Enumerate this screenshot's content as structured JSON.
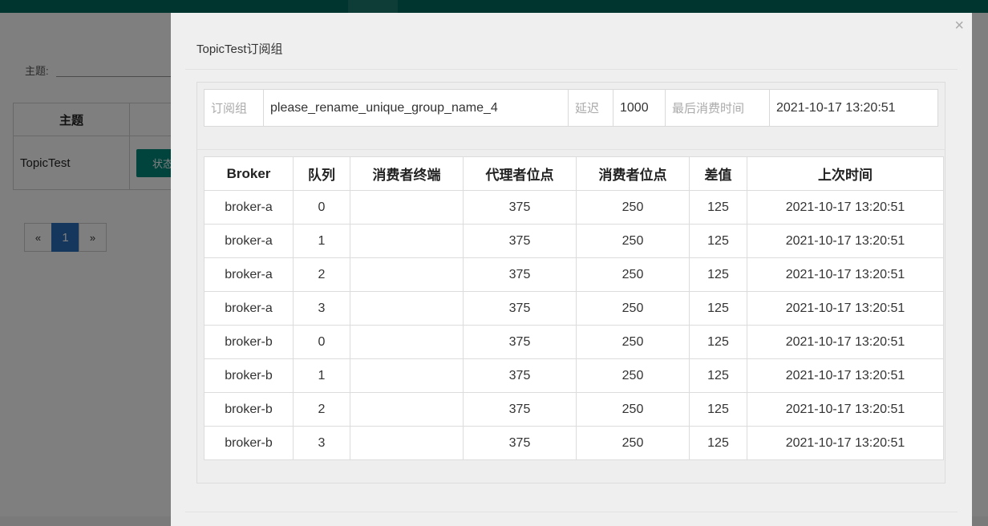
{
  "background": {
    "filter_label": "主题:",
    "table_header": "主题",
    "topic_row_name": "TopicTest",
    "status_button_label": "状态",
    "pagination": {
      "prev": "«",
      "current": "1",
      "next": "»"
    }
  },
  "modal": {
    "title": "TopicTest订阅组",
    "close": "×",
    "info": {
      "group_label": "订阅组",
      "group_value": "please_rename_unique_group_name_4",
      "delay_label": "延迟",
      "delay_value": "1000",
      "last_consume_label": "最后消费时间",
      "last_consume_value": "2021-10-17 13:20:51"
    },
    "table": {
      "headers": [
        "Broker",
        "队列",
        "消费者终端",
        "代理者位点",
        "消费者位点",
        "差值",
        "上次时间"
      ],
      "rows": [
        [
          "broker-a",
          "0",
          "",
          "375",
          "250",
          "125",
          "2021-10-17 13:20:51"
        ],
        [
          "broker-a",
          "1",
          "",
          "375",
          "250",
          "125",
          "2021-10-17 13:20:51"
        ],
        [
          "broker-a",
          "2",
          "",
          "375",
          "250",
          "125",
          "2021-10-17 13:20:51"
        ],
        [
          "broker-a",
          "3",
          "",
          "375",
          "250",
          "125",
          "2021-10-17 13:20:51"
        ],
        [
          "broker-b",
          "0",
          "",
          "375",
          "250",
          "125",
          "2021-10-17 13:20:51"
        ],
        [
          "broker-b",
          "1",
          "",
          "375",
          "250",
          "125",
          "2021-10-17 13:20:51"
        ],
        [
          "broker-b",
          "2",
          "",
          "375",
          "250",
          "125",
          "2021-10-17 13:20:51"
        ],
        [
          "broker-b",
          "3",
          "",
          "375",
          "250",
          "125",
          "2021-10-17 13:20:51"
        ]
      ]
    }
  },
  "colors": {
    "nav": "#00695c",
    "status_button": "#00897b",
    "page_active": "#2a6ebb"
  }
}
